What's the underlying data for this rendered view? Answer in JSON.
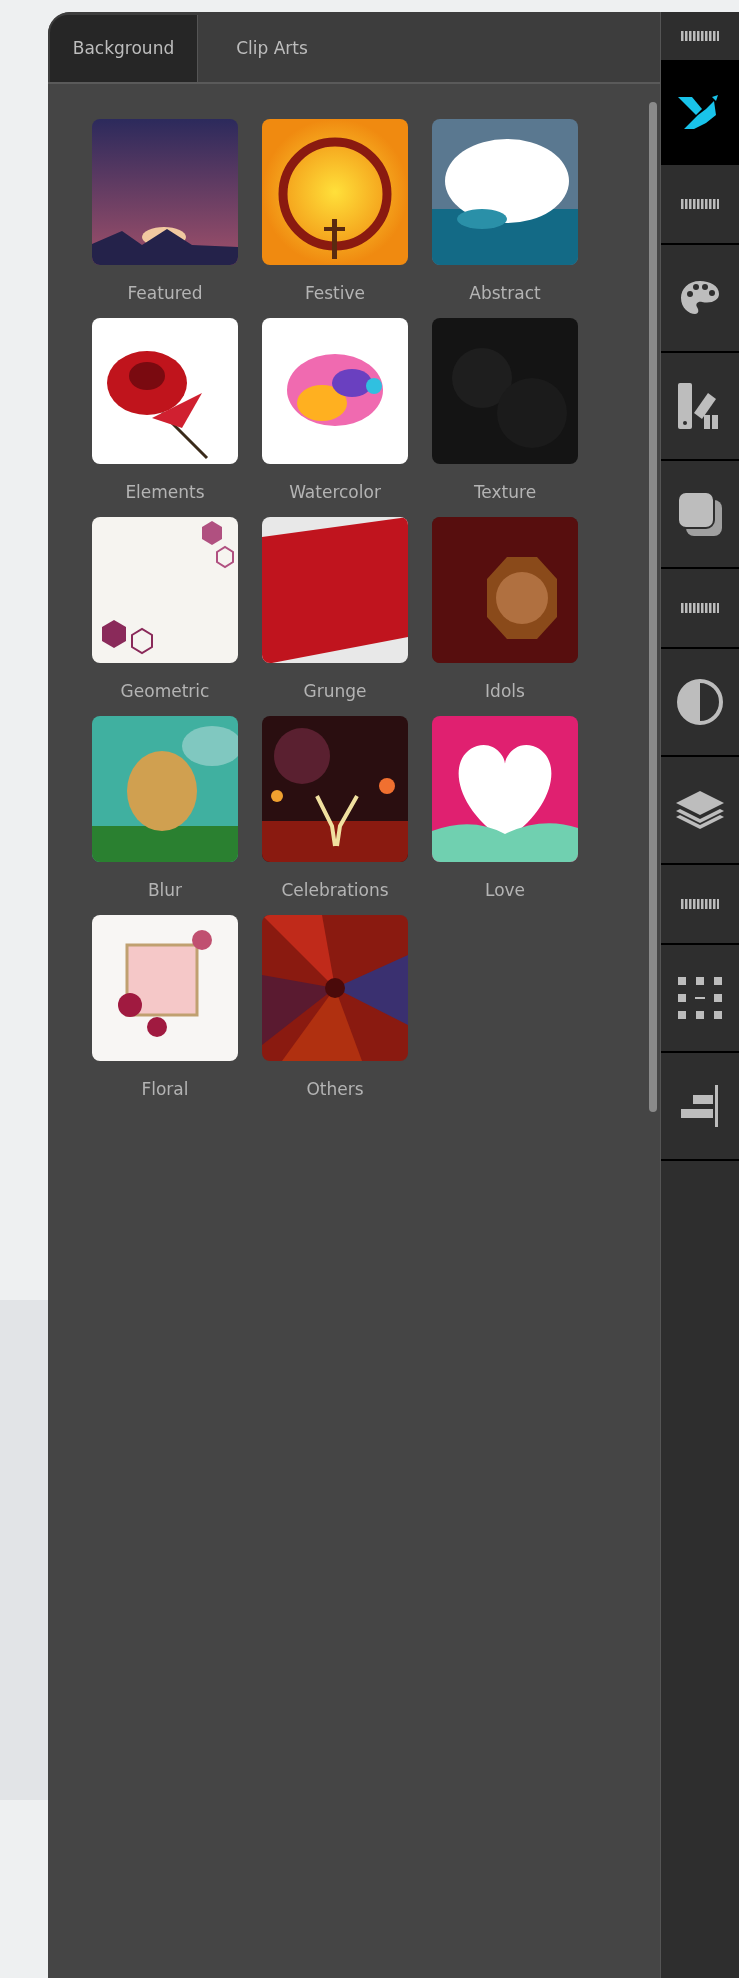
{
  "tabs": [
    {
      "label": "Background",
      "selected": true
    },
    {
      "label": "Clip Arts",
      "selected": false
    }
  ],
  "categories": [
    {
      "label": "Featured"
    },
    {
      "label": "Festive"
    },
    {
      "label": "Abstract"
    },
    {
      "label": "Elements"
    },
    {
      "label": "Watercolor"
    },
    {
      "label": "Texture"
    },
    {
      "label": "Geometric"
    },
    {
      "label": "Grunge"
    },
    {
      "label": "Idols"
    },
    {
      "label": "Blur"
    },
    {
      "label": "Celebrations"
    },
    {
      "label": "Love"
    },
    {
      "label": "Floral"
    },
    {
      "label": "Others"
    }
  ],
  "sidebar": {
    "items": [
      {
        "kind": "grip",
        "selected": false
      },
      {
        "kind": "logo",
        "selected": true
      },
      {
        "kind": "grip",
        "selected": false
      },
      {
        "kind": "palette",
        "selected": false
      },
      {
        "kind": "swatches",
        "selected": false
      },
      {
        "kind": "shadow",
        "selected": false
      },
      {
        "kind": "grip",
        "selected": false
      },
      {
        "kind": "contrast",
        "selected": false
      },
      {
        "kind": "layers",
        "selected": false
      },
      {
        "kind": "grip",
        "selected": false
      },
      {
        "kind": "selection",
        "selected": false
      },
      {
        "kind": "align",
        "selected": false
      }
    ]
  }
}
